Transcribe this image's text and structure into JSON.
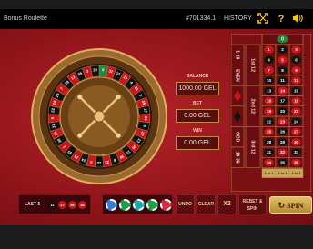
{
  "topbar": {
    "title": "Bonus Roulette",
    "round_id": "#701334.1",
    "history_label": "HISTORY",
    "icons": [
      "fullscreen-icon",
      "help-icon",
      "sound-icon"
    ],
    "help_glyph": "?"
  },
  "info": {
    "balance_label": "BALANCE",
    "balance_value": "1000.00 GEL",
    "bet_label": "BET",
    "bet_value": "0.00 GEL",
    "win_label": "WIN",
    "win_value": "0.00 GEL"
  },
  "board": {
    "zero": "0",
    "rows": [
      [
        "1",
        "2",
        "3"
      ],
      [
        "4",
        "5",
        "6"
      ],
      [
        "7",
        "8",
        "9"
      ],
      [
        "10",
        "11",
        "12"
      ],
      [
        "13",
        "14",
        "15"
      ],
      [
        "16",
        "17",
        "18"
      ],
      [
        "19",
        "20",
        "21"
      ],
      [
        "22",
        "23",
        "24"
      ],
      [
        "25",
        "26",
        "27"
      ],
      [
        "28",
        "29",
        "30"
      ],
      [
        "31",
        "32",
        "33"
      ],
      [
        "34",
        "35",
        "36"
      ]
    ],
    "red_numbers": [
      1,
      3,
      5,
      7,
      9,
      12,
      14,
      16,
      18,
      19,
      21,
      23,
      25,
      27,
      30,
      32,
      34,
      36
    ],
    "outside_bets": [
      "1-18",
      "EVEN",
      "◆",
      "◆",
      "ODD",
      "19-36"
    ],
    "dozens": [
      "1st 12",
      "2nd 12",
      "3rd 12"
    ],
    "columns": [
      "2 to 1",
      "2 to 1",
      "2 to 1"
    ]
  },
  "bottom": {
    "last_label": "LAST 5",
    "last_numbers": [
      {
        "n": "11",
        "color": "#111111"
      },
      {
        "n": "27",
        "color": "#c8161d"
      },
      {
        "n": "36",
        "color": "#c8161d"
      },
      {
        "n": "36",
        "color": "#c8161d"
      }
    ],
    "chips": [
      {
        "label": "",
        "color": "#2e7bd6"
      },
      {
        "label": "",
        "color": "#1d9e4a"
      },
      {
        "label": "",
        "color": "#1aa7b0"
      },
      {
        "label": "",
        "color": "#18a34a"
      },
      {
        "label": "",
        "color": "#d8283c"
      }
    ],
    "undo": "UNDO",
    "clear": "CLEAR",
    "x2": "X2",
    "rebet": "REBET & SPIN",
    "spin": "SPIN",
    "spin_glyph": "↻"
  },
  "colors": {
    "felt": "#a31a20",
    "gold": "#c08b45",
    "number_red": "#c8161d",
    "number_black": "#111111",
    "zero_green": "#1b8a3a"
  },
  "wheel": {
    "order": [
      0,
      32,
      15,
      19,
      4,
      21,
      2,
      25,
      17,
      34,
      6,
      27,
      13,
      36,
      11,
      30,
      8,
      23,
      10,
      5,
      24,
      16,
      33,
      1,
      20,
      14,
      31,
      9,
      22,
      18,
      29,
      7,
      28,
      12,
      35,
      3,
      26
    ]
  }
}
